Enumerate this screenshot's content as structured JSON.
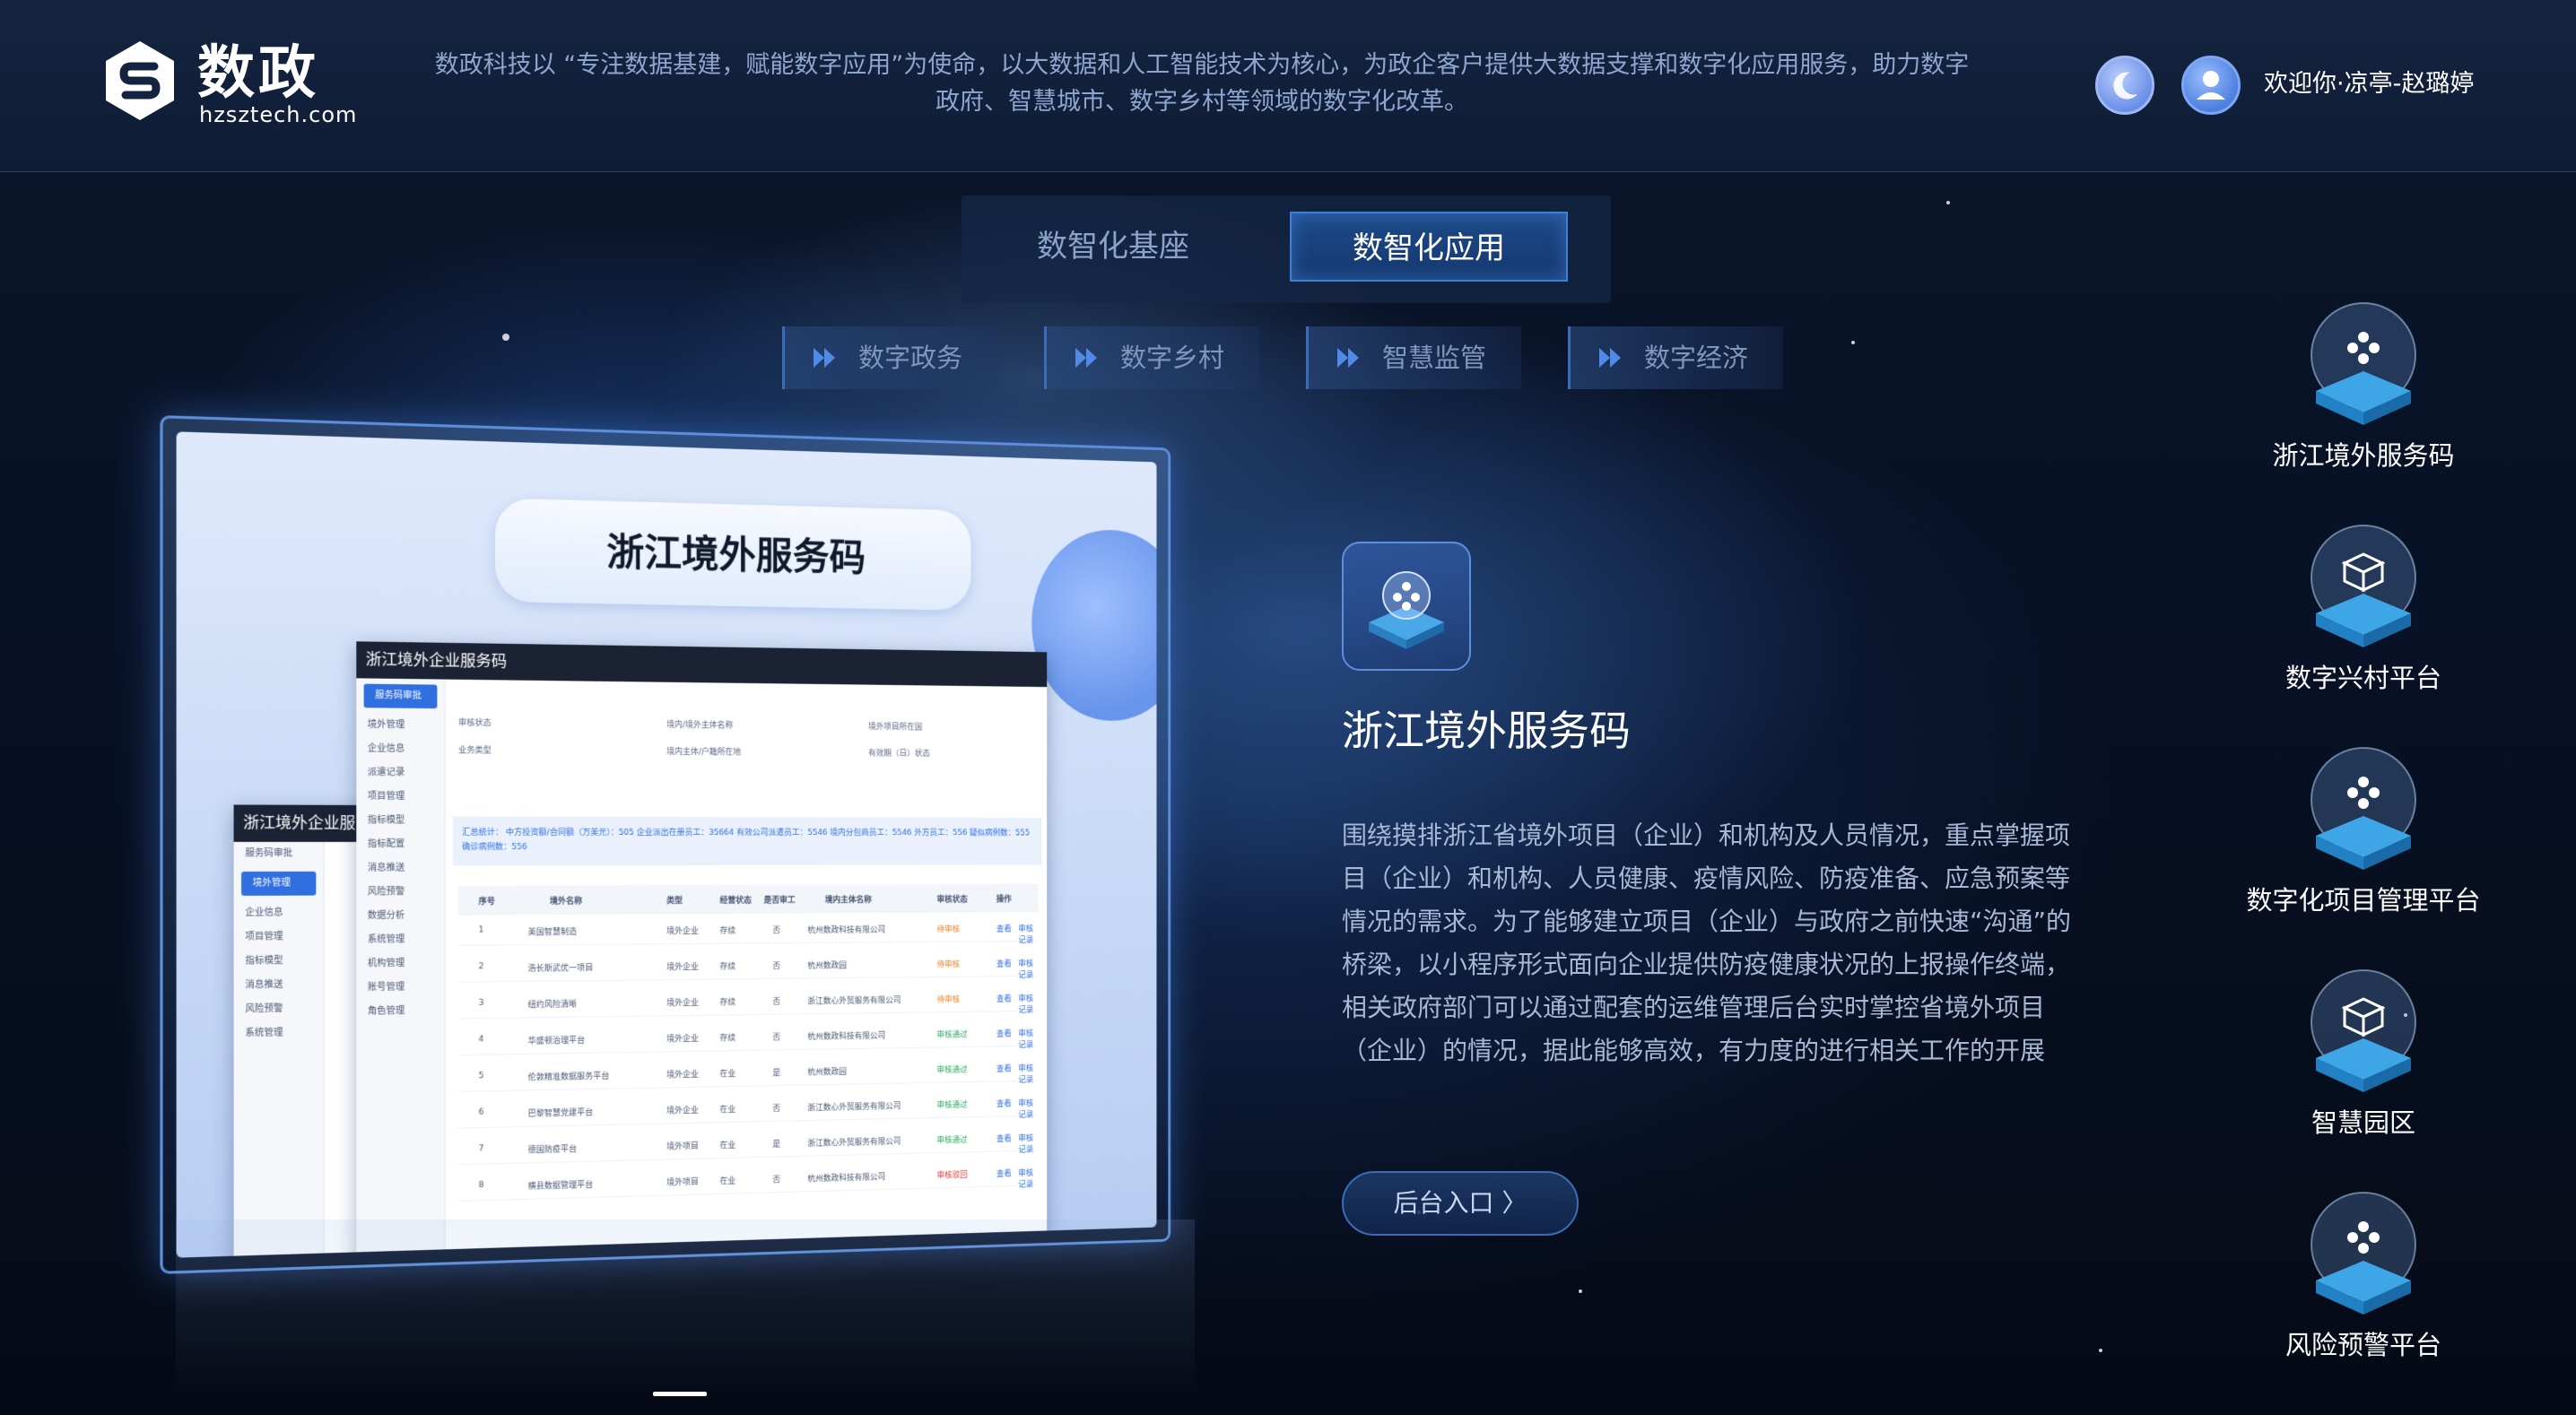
{
  "header": {
    "logo_title": "数政",
    "logo_domain": "hzsztech.com",
    "description": "数政科技以 “专注数据基建，赋能数字应用”为使命，以大数据和人工智能技术为核心，为政企客户提供大数据支撑和数字化应用服务，助力数字政府、智慧城市、数字乡村等领域的数字化改革。",
    "welcome": "欢迎你·凉亭-赵璐婷"
  },
  "main_tabs": [
    {
      "label": "数智化基座",
      "active": false
    },
    {
      "label": "数智化应用",
      "active": true
    }
  ],
  "sub_tabs": [
    {
      "label": "数字政务"
    },
    {
      "label": "数字乡村"
    },
    {
      "label": "智慧监管"
    },
    {
      "label": "数字经济"
    }
  ],
  "preview": {
    "title": "浙江境外服务码",
    "window_title": "浙江境外企业服务码",
    "sidebar_items": [
      "服务码审批",
      "境外管理",
      "企业信息",
      "派遣记录",
      "项目管理",
      "指标模型",
      "指标配置",
      "消息推送",
      "风险预警",
      "数据分析",
      "系统管理",
      "机构管理",
      "账号管理",
      "角色管理"
    ],
    "filters": [
      "审核状态",
      "境内/境外主体名称",
      "境外项目所在国",
      "业务类型",
      "境内主体/户籍所在地",
      "有效期（日）状态"
    ],
    "summary": "汇总统计： 中方投资额/合同额（万美元）：505  企业派出在册员工：35664  有效公司派遣员工：5546  境内分包商员工：5546  外方员工：556  疑似病例数：555  确诊病例数：556",
    "table_headers": [
      "序号",
      "境外名称",
      "类型",
      "经营状态",
      "是否审工",
      "境内主体名称",
      "审核状态",
      "操作"
    ],
    "rows": [
      {
        "no": "1",
        "name": "美国智慧制造",
        "type": "境外企业",
        "state": "存续",
        "flag": "否",
        "owner": "杭州数政科技有限公司",
        "status": "待审核",
        "status_type": "orange"
      },
      {
        "no": "2",
        "name": "浩长斯武优一项目",
        "type": "境外企业",
        "state": "存续",
        "flag": "否",
        "owner": "杭州数政园",
        "status": "待审核",
        "status_type": "orange"
      },
      {
        "no": "3",
        "name": "纽约风险清晰",
        "type": "境外企业",
        "state": "存续",
        "flag": "否",
        "owner": "浙江数心外贸服务有限公司",
        "status": "待审核",
        "status_type": "orange"
      },
      {
        "no": "4",
        "name": "华盛顿治理平台",
        "type": "境外企业",
        "state": "存续",
        "flag": "否",
        "owner": "杭州数政科技有限公司",
        "status": "审核通过",
        "status_type": "green"
      },
      {
        "no": "5",
        "name": "伦敦精准数据服务平台",
        "type": "境外企业",
        "state": "在业",
        "flag": "是",
        "owner": "杭州数政园",
        "status": "审核通过",
        "status_type": "green"
      },
      {
        "no": "6",
        "name": "巴黎智慧党建平台",
        "type": "境外企业",
        "state": "在业",
        "flag": "否",
        "owner": "浙江数心外贸服务有限公司",
        "status": "审核通过",
        "status_type": "green"
      },
      {
        "no": "7",
        "name": "德国防疫平台",
        "type": "境外项目",
        "state": "在业",
        "flag": "是",
        "owner": "浙江数心外贸服务有限公司",
        "status": "审核通过",
        "status_type": "green"
      },
      {
        "no": "8",
        "name": "横县数据管理平台",
        "type": "境外项目",
        "state": "在业",
        "flag": "否",
        "owner": "杭州数政科技有限公司",
        "status": "审核驳回",
        "status_type": "red"
      }
    ],
    "op_view": "查看",
    "op_record": "审核记录"
  },
  "detail": {
    "title": "浙江境外服务码",
    "description": "围绕摸排浙江省境外项目（企业）和机构及人员情况，重点掌握项目（企业）和机构、人员健康、疫情风险、防疫准备、应急预案等情况的需求。为了能够建立项目（企业）与政府之前快速“沟通”的桥梁，以小程序形式面向企业提供防疫健康状况的上报操作终端， 相关政府部门可以通过配套的运维管理后台实时掌控省境外项目（企业）的情况，据此能够高效，有力度的进行相关工作的开展",
    "backend_button": "后台入口 〉"
  },
  "right_nav": [
    {
      "label": "浙江境外服务码",
      "icon": "network-cube-icon"
    },
    {
      "label": "数字兴村平台",
      "icon": "box-cube-icon"
    },
    {
      "label": "数字化项目管理平台",
      "icon": "network-cube-icon"
    },
    {
      "label": "智慧园区",
      "icon": "box-cube-icon"
    },
    {
      "label": "风险预警平台",
      "icon": "network-cube-icon"
    }
  ],
  "colors": {
    "header_bg": "#14233f",
    "accent": "#3f7fd6",
    "text_muted": "#8ea6cf"
  }
}
